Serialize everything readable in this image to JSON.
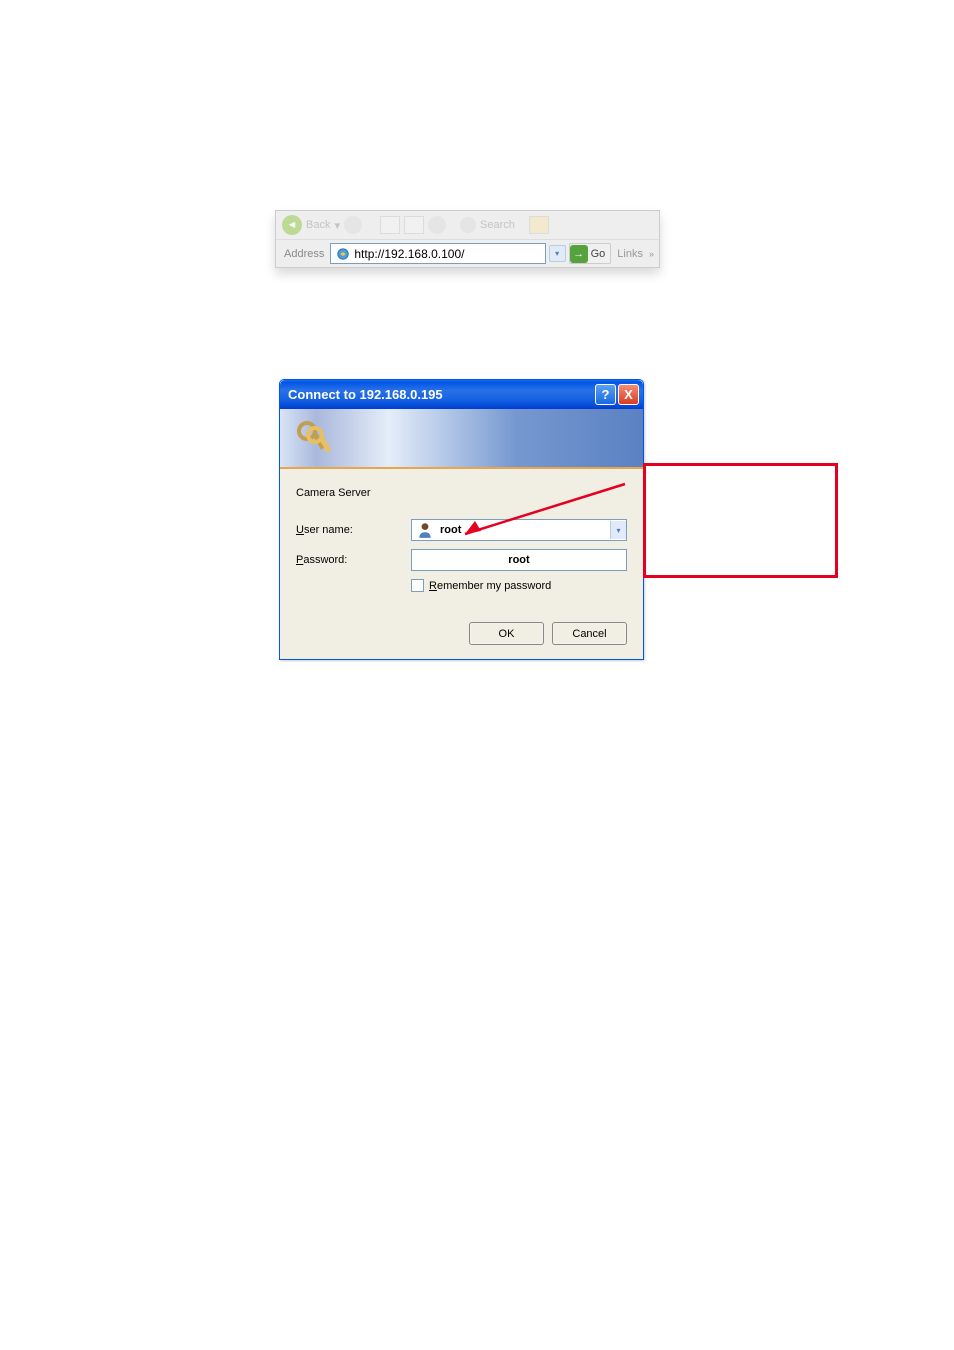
{
  "browser": {
    "back_label": "Back",
    "search_label": "Search",
    "address_label": "Address",
    "url": "http://192.168.0.100/",
    "go_label": "Go",
    "links_label": "Links"
  },
  "dialog": {
    "title": "Connect to 192.168.0.195",
    "server_name": "Camera Server",
    "username_label_prefix": "U",
    "username_label_rest": "ser name:",
    "password_label_prefix": "P",
    "password_label_rest": "assword:",
    "username_value": "root",
    "password_value": "root",
    "remember_prefix": "R",
    "remember_rest": "emember my password",
    "ok_label": "OK",
    "cancel_label": "Cancel",
    "help_symbol": "?",
    "close_symbol": "X"
  }
}
